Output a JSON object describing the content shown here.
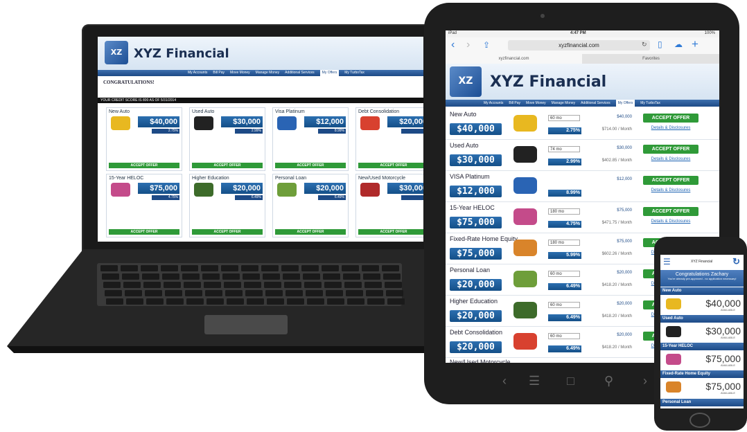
{
  "brand": {
    "name": "XYZ Financial",
    "logo_letters": "XZ"
  },
  "colors": {
    "brand_blue": "#1d4a86",
    "accept_green": "#2f9a38",
    "link_blue": "#1d63b2"
  },
  "laptop": {
    "nav": [
      "My Accounts",
      "Bill Pay",
      "Move Money",
      "Manage Money",
      "Additional Services",
      "My Offers",
      "My TurboTax"
    ],
    "active_nav": "My Offers",
    "headline": "CONGRATULATIONS!",
    "credit_bar": "YOUR CREDIT SCORE IS 800 AS OF 5/31/2014",
    "cards": [
      {
        "title": "New Auto",
        "amount": "$40,000",
        "rate": "2.75%",
        "button": "ACCEPT OFFER",
        "icon": "car-icon"
      },
      {
        "title": "Used Auto",
        "amount": "$30,000",
        "rate": "2.99%",
        "button": "ACCEPT OFFER",
        "icon": "car-icon"
      },
      {
        "title": "Visa Platinum",
        "amount": "$12,000",
        "rate": "8.99%",
        "button": "ACCEPT OFFER",
        "icon": "credit-card-icon"
      },
      {
        "title": "Debt Consolidation",
        "amount": "$20,000",
        "rate": "",
        "button": "ACCEPT OFFER",
        "icon": "life-ring-icon"
      },
      {
        "title": "15-Year HELOC",
        "amount": "$75,000",
        "rate": "4.75%",
        "button": "ACCEPT OFFER",
        "icon": "color-fan-icon"
      },
      {
        "title": "Higher Education",
        "amount": "$20,000",
        "rate": "6.49%",
        "button": "ACCEPT OFFER",
        "icon": "graduation-cap-icon"
      },
      {
        "title": "Personal Loan",
        "amount": "$20,000",
        "rate": "6.49%",
        "button": "ACCEPT OFFER",
        "icon": "money-icon"
      },
      {
        "title": "New/Used Motorcycle",
        "amount": "$30,000",
        "rate": "",
        "button": "ACCEPT OFFER",
        "icon": "motorcycle-icon"
      }
    ]
  },
  "tablet": {
    "status": {
      "left": "iPad",
      "time": "4:47 PM",
      "battery": "100%"
    },
    "url": "xyzfinancial.com",
    "tabs": [
      "xyzfinancial.com",
      "Favorites"
    ],
    "nav": [
      "My Accounts",
      "Bill Pay",
      "Move Money",
      "Manage Money",
      "Additional Services",
      "My Offers",
      "My TurboTax"
    ],
    "active_nav": "My Offers",
    "rows": [
      {
        "label": "New Auto",
        "amount": "$40,000",
        "rate": "2.75%",
        "term": "60 mo",
        "loan": "$40,000",
        "monthly": "$714.00 / Month",
        "button": "ACCEPT OFFER",
        "link": "Details & Disclosures",
        "icon": "car-icon",
        "icon_color": "#e8b820"
      },
      {
        "label": "Used Auto",
        "amount": "$30,000",
        "rate": "2.99%",
        "term": "74 mo",
        "loan": "$30,000",
        "monthly": "$402.85 / Month",
        "button": "ACCEPT OFFER",
        "link": "Details & Disclosures",
        "icon": "car-icon",
        "icon_color": "#222222"
      },
      {
        "label": "VISA Platinum",
        "amount": "$12,000",
        "rate": "8.99%",
        "term": "",
        "loan": "$12,000",
        "monthly": "",
        "button": "ACCEPT OFFER",
        "link": "Details & Disclosures",
        "icon": "credit-card-icon",
        "icon_color": "#2a64b4"
      },
      {
        "label": "15-Year HELOC",
        "amount": "$75,000",
        "rate": "4.75%",
        "term": "180 mo",
        "loan": "$75,000",
        "monthly": "$471.75 / Month",
        "button": "ACCEPT OFFER",
        "link": "Details & Disclosures",
        "icon": "color-fan-icon",
        "icon_color": "#c44b8a"
      },
      {
        "label": "Fixed-Rate Home Equity",
        "amount": "$75,000",
        "rate": "5.99%",
        "term": "180 mo",
        "loan": "$75,000",
        "monthly": "$602.26 / Month",
        "button": "ACCEPT OFFER",
        "link": "Details & Disclosures",
        "icon": "house-icon",
        "icon_color": "#d9842a"
      },
      {
        "label": "Personal Loan",
        "amount": "$20,000",
        "rate": "6.49%",
        "term": "60 mo",
        "loan": "$20,000",
        "monthly": "$418.20 / Month",
        "button": "ACCEPT OFFER",
        "link": "Details & Disclosures",
        "icon": "money-icon",
        "icon_color": "#6e9e3a"
      },
      {
        "label": "Higher Education",
        "amount": "$20,000",
        "rate": "6.49%",
        "term": "60 mo",
        "loan": "$20,000",
        "monthly": "$418.20 / Month",
        "button": "ACCEPT OFFER",
        "link": "Details & Disclosures",
        "icon": "graduation-cap-icon",
        "icon_color": "#3d6b2a"
      },
      {
        "label": "Debt Consolidation",
        "amount": "$20,000",
        "rate": "6.49%",
        "term": "60 mo",
        "loan": "$20,000",
        "monthly": "$418.20 / Month",
        "button": "ACCEPT OFFER",
        "link": "Details & Disclosures",
        "icon": "life-ring-icon",
        "icon_color": "#d8412f"
      }
    ],
    "next_label": "New/Used Motorcycle"
  },
  "phone": {
    "header": "XYZ Financial",
    "greeting": "Congratulations Zachary",
    "subtext": "You're already pre-approved - no application necessary!",
    "items": [
      {
        "section": "New Auto",
        "amount": "$40,000",
        "avail": "AVAILABLE",
        "icon": "car-icon",
        "icon_color": "#e8b820"
      },
      {
        "section": "Used Auto",
        "amount": "$30,000",
        "avail": "AVAILABLE",
        "icon": "car-icon",
        "icon_color": "#222222"
      },
      {
        "section": "15-Year HELOC",
        "amount": "$75,000",
        "avail": "AVAILABLE",
        "icon": "color-fan-icon",
        "icon_color": "#c44b8a"
      },
      {
        "section": "Fixed-Rate Home Equity",
        "amount": "$75,000",
        "avail": "AVAILABLE",
        "icon": "house-icon",
        "icon_color": "#d9842a"
      }
    ],
    "last_section": "Personal Loan"
  }
}
